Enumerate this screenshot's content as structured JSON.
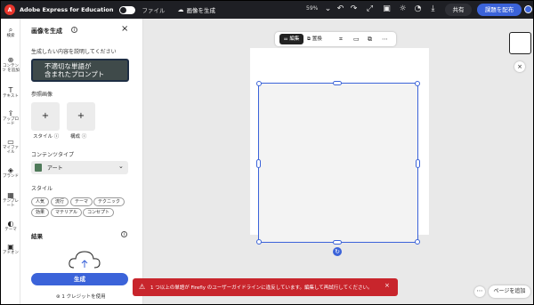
{
  "topbar": {
    "logo_text": "A",
    "app_title": "Adobe Express for Education",
    "file_menu": "ファイル",
    "doc_title": "画像を生成",
    "zoom": "59%",
    "share_label": "共有",
    "publish_label": "課題を配布"
  },
  "rail": {
    "items": [
      {
        "icon": "⌕",
        "label": "検索"
      },
      {
        "icon": "⊕",
        "label": "コンテンツ\nを追加"
      },
      {
        "icon": "T",
        "label": "テキスト"
      },
      {
        "icon": "⇪",
        "label": "アップロード"
      },
      {
        "icon": "▭",
        "label": "マイファイル"
      },
      {
        "icon": "◈",
        "label": "ブランド"
      },
      {
        "icon": "▦",
        "label": "テンプレート"
      },
      {
        "icon": "◐",
        "label": "テーマ"
      },
      {
        "icon": "▣",
        "label": "アドオン"
      }
    ]
  },
  "panel": {
    "title": "画像を生成",
    "prompt_label": "生成したい内容を説明してください",
    "prompt_text_line1": "不適切な単語が",
    "prompt_text_line2": "含まれたプロンプト",
    "ref_label": "参照画像",
    "ref_style_caption": "スタイル",
    "ref_composition_caption": "構成",
    "content_type_label": "コンテンツタイプ",
    "content_type_value": "アート",
    "style_label": "スタイル",
    "style_chips": [
      "人気",
      "流行",
      "テーマ",
      "テクニック",
      "効果",
      "マテリアル",
      "コンセプト"
    ],
    "result_label": "結果",
    "generate_label": "生成",
    "credit_text": "1 クレジットを使用"
  },
  "canvas": {
    "toolbar_edit": "編集",
    "toolbar_duplicate": "置換",
    "error_message": "1 つ以上の単語が Firefly のユーザーガイドラインに違反しています。編集して再試行してください。",
    "add_page_label": "ページを追加"
  },
  "colors": {
    "accent": "#3b63d9",
    "error": "#c8252c",
    "topbar": "#1e1f24"
  }
}
